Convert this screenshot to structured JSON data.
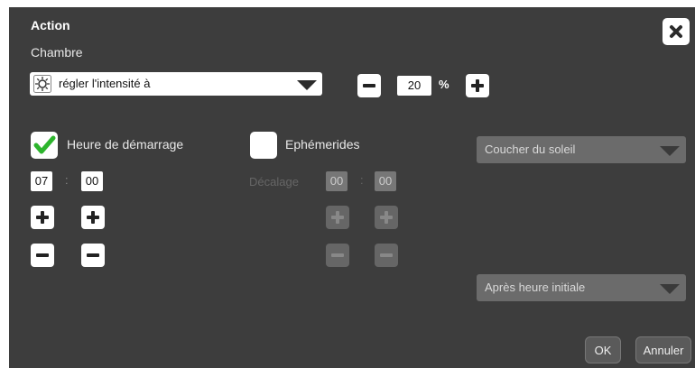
{
  "dialog": {
    "title": "Action",
    "room": "Chambre",
    "close_icon": "close-icon"
  },
  "action": {
    "select_value": "régler l'intensité à",
    "icon": "brightness-icon",
    "percent_value": "20",
    "percent_symbol": "%"
  },
  "start_time": {
    "checked": true,
    "label": "Heure de démarrage",
    "hour": "07",
    "minute": "00",
    "separator": ":"
  },
  "ephemerides": {
    "checked": false,
    "label": "Ephémerides",
    "offset_label": "Décalage",
    "hour": "00",
    "minute": "00",
    "separator": ":"
  },
  "dropdowns": {
    "sun_event": "Coucher du soleil",
    "relation": "Après heure initiale"
  },
  "footer": {
    "ok_label": "OK",
    "cancel_label": "Annuler"
  }
}
